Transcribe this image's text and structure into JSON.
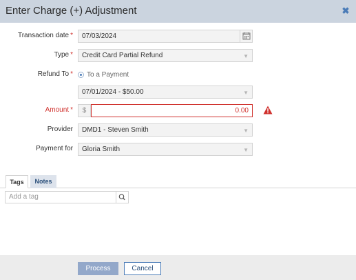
{
  "dialog": {
    "title": "Enter Charge (+) Adjustment",
    "close_icon": "close-icon"
  },
  "form": {
    "transaction_date": {
      "label": "Transaction date",
      "value": "07/03/2024",
      "required": "*"
    },
    "type": {
      "label": "Type",
      "value": "Credit Card Partial Refund",
      "required": "*"
    },
    "refund_to": {
      "label": "Refund To",
      "required": "*",
      "option_label": "To a Payment",
      "payment_value": "07/01/2024 - $50.00"
    },
    "amount": {
      "label": "Amount",
      "required": "*",
      "currency_symbol": "$",
      "value": "0.00"
    },
    "provider": {
      "label": "Provider",
      "value": "DMD1 - Steven Smith"
    },
    "payment_for": {
      "label": "Payment for",
      "value": "Gloria Smith"
    }
  },
  "tabs": [
    {
      "label": "Tags",
      "active": true
    },
    {
      "label": "Notes",
      "active": false
    }
  ],
  "tags": {
    "placeholder": "Add a tag"
  },
  "footer": {
    "process_label": "Process",
    "cancel_label": "Cancel"
  },
  "colors": {
    "header_bg": "#cbd4df",
    "error": "#d0312d",
    "accent": "#4a7bb7",
    "primary_button": "#93a8ca"
  }
}
